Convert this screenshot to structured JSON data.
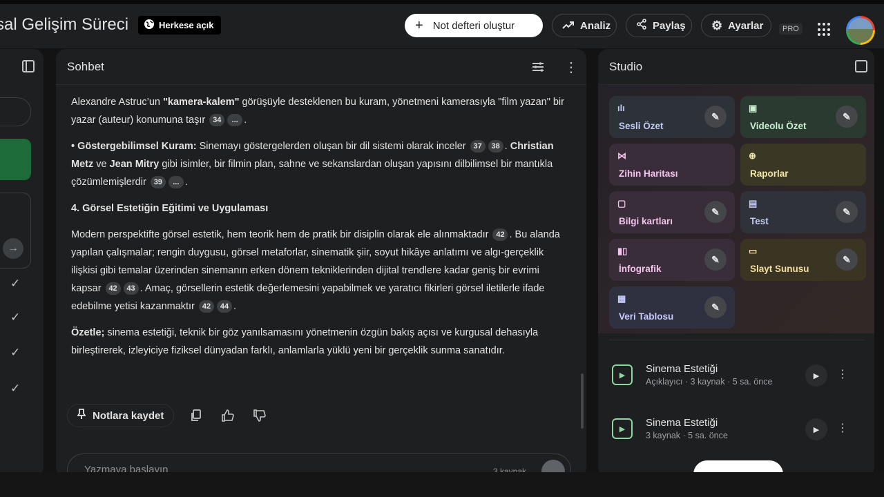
{
  "app": {
    "title": "sal Gelişim Süreci",
    "visibility": "Herkese açık"
  },
  "toolbar": {
    "create_notebook": "Not defteri oluştur",
    "analyze": "Analiz",
    "share": "Paylaş",
    "settings": "Ayarlar",
    "pro": "PRO"
  },
  "chat": {
    "header": "Sohbet",
    "p1_cont": "Alexandre Astruc’un ",
    "p1_bold": "\"kamera-kalem\"",
    "p1_rest": " görüşüyle desteklenen bu kuram, yönetmeni kamerasıyla \"film yazan\" bir yazar (auteur) konumuna taşır",
    "p1_cite": "34",
    "more": "...",
    "p2_bullet": "• ",
    "p2_bold": "Göstergebilimsel Kuram:",
    "p2_text": " Sinemayı göstergelerden oluşan bir dil sistemi olarak inceler",
    "p2_c1": "37",
    "p2_c2": "38",
    "p2_b2": "Christian Metz",
    "p2_and": " ve ",
    "p2_b3": "Jean Mitry",
    "p2_rest": " gibi isimler, bir filmin plan, sahne ve sekanslardan oluşan yapısını dilbilimsel bir mantıkla çözümlemişlerdir",
    "p2_c3": "39",
    "heading": "4. Görsel Estetiğin Eğitimi ve Uygulaması",
    "p3_a": "Modern perspektifte görsel estetik, hem teorik hem de pratik bir disiplin olarak ele alınmaktadır",
    "p3_c1": "42",
    "p3_b": ". Bu alanda yapılan çalışmalar; rengin duygusu, görsel metaforlar, sinematik şiir, soyut hikâye anlatımı ve algı-gerçeklik ilişkisi gibi temalar üzerinden sinemanın erken dönem tekniklerinden dijital trendlere kadar geniş bir evrimi kapsar",
    "p3_c2": "42",
    "p3_c3": "43",
    "p3_c": ". Amaç, görsellerin estetik değerlemesini yapabilmek ve yaratıcı fikirleri görsel iletilerle ifade edebilme yetisi kazanmaktır",
    "p3_c4": "42",
    "p3_c5": "44",
    "p4_bold": "Özetle;",
    "p4_text": " sinema estetiği, teknik bir göz yanılsamasını yönetmenin özgün bakış açısı ve kurgusal dehasıyla birleştirerek, izleyiciye fiziksel dünyadan farklı, anlamlarla yüklü yeni bir gerçeklik sunma sanatıdır.",
    "save_to_notes": "Notlara kaydet",
    "input_placeholder": "Yazmaya başlayın",
    "source_count": "3 kaynak"
  },
  "studio": {
    "header": "Studio",
    "tiles": [
      {
        "label": "Sesli Özet"
      },
      {
        "label": "Videolu Özet"
      },
      {
        "label": "Zihin Haritası"
      },
      {
        "label": "Raporlar"
      },
      {
        "label": "Bilgi kartları"
      },
      {
        "label": "Test"
      },
      {
        "label": "İnfografik"
      },
      {
        "label": "Slayt Sunusu"
      },
      {
        "label": "Veri Tablosu"
      }
    ],
    "notes": [
      {
        "title": "Sinema Estetiği",
        "meta": "Açıklayıcı · 3 kaynak · 5 sa. önce"
      },
      {
        "title": "Sinema Estetiği",
        "meta": "3 kaynak · 5 sa. önce"
      }
    ]
  }
}
